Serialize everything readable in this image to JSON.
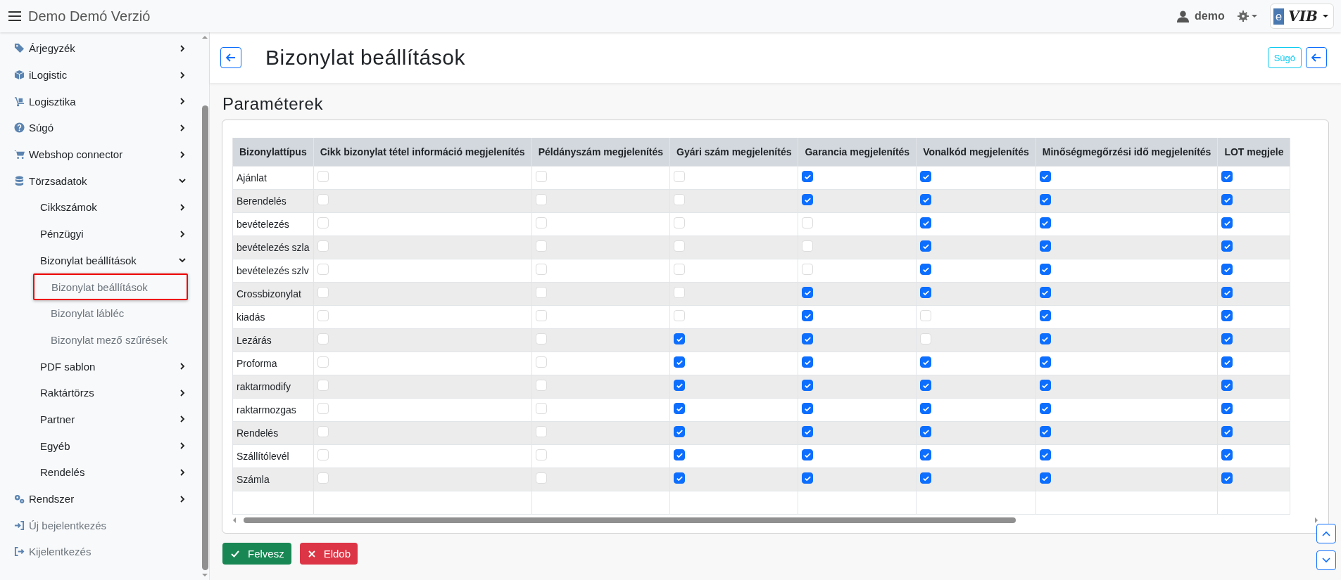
{
  "topbar": {
    "title": "Demo Demó Verzió",
    "user": "demo",
    "logo": {
      "mark": "e",
      "text": "VIB"
    }
  },
  "sidebar": {
    "items": [
      {
        "label": "Árjegyzék",
        "expanded": false
      },
      {
        "label": "iLogistic",
        "expanded": false
      },
      {
        "label": "Logisztika",
        "expanded": false
      },
      {
        "label": "Súgó",
        "expanded": false
      },
      {
        "label": "Webshop connector",
        "expanded": false
      },
      {
        "label": "Törzsadatok",
        "expanded": true,
        "children": [
          {
            "label": "Cikkszámok",
            "expanded": false
          },
          {
            "label": "Pénzügyi",
            "expanded": false
          },
          {
            "label": "Bizonylat beállítások",
            "expanded": true,
            "children": [
              {
                "label": "Bizonylat beállítások",
                "selected": true
              },
              {
                "label": "Bizonylat lábléc",
                "selected": false
              },
              {
                "label": "Bizonylat mező szűrések",
                "selected": false
              }
            ]
          },
          {
            "label": "PDF sablon",
            "expanded": false
          },
          {
            "label": "Raktártörzs",
            "expanded": false
          },
          {
            "label": "Partner",
            "expanded": false
          },
          {
            "label": "Egyéb",
            "expanded": false
          },
          {
            "label": "Rendelés",
            "expanded": false
          }
        ]
      },
      {
        "label": "Rendszer",
        "expanded": false
      }
    ],
    "actions": [
      "Új bejelentkezés",
      "Kijelentkezés"
    ]
  },
  "page": {
    "title": "Bizonylat beállítások",
    "help_button": "Súgó",
    "section": "Paraméterek"
  },
  "table": {
    "columns": [
      "Bizonylattípus",
      "Cikk bizonylat tétel információ megjelenítés",
      "Példányszám megjelenítés",
      "Gyári szám megjelenítés",
      "Garancia megjelenítés",
      "Vonalkód megjelenítés",
      "Minőségmegőrzési idő megjelenítés",
      "LOT megjele"
    ],
    "rows": [
      {
        "name": "Ajánlat",
        "checks": [
          false,
          false,
          false,
          true,
          true,
          true,
          true
        ]
      },
      {
        "name": "Berendelés",
        "checks": [
          false,
          false,
          false,
          true,
          true,
          true,
          true
        ]
      },
      {
        "name": "bevételezés",
        "checks": [
          false,
          false,
          false,
          false,
          true,
          true,
          true
        ]
      },
      {
        "name": "bevételezés szla",
        "checks": [
          false,
          false,
          false,
          false,
          true,
          true,
          true
        ]
      },
      {
        "name": "bevételezés szlv",
        "checks": [
          false,
          false,
          false,
          false,
          true,
          true,
          true
        ]
      },
      {
        "name": "Crossbizonylat",
        "checks": [
          false,
          false,
          false,
          true,
          true,
          true,
          true
        ]
      },
      {
        "name": "kiadás",
        "checks": [
          false,
          false,
          false,
          true,
          false,
          true,
          true
        ]
      },
      {
        "name": "Lezárás",
        "checks": [
          false,
          false,
          true,
          true,
          false,
          true,
          true
        ]
      },
      {
        "name": "Proforma",
        "checks": [
          false,
          false,
          true,
          true,
          true,
          true,
          true
        ]
      },
      {
        "name": "raktarmodify",
        "checks": [
          false,
          false,
          true,
          true,
          true,
          true,
          true
        ]
      },
      {
        "name": "raktarmozgas",
        "checks": [
          false,
          false,
          true,
          true,
          true,
          true,
          true
        ]
      },
      {
        "name": "Rendelés",
        "checks": [
          false,
          false,
          true,
          true,
          true,
          true,
          true
        ]
      },
      {
        "name": "Szállítólevél",
        "checks": [
          false,
          false,
          true,
          true,
          true,
          true,
          true
        ]
      },
      {
        "name": "Számla",
        "checks": [
          false,
          false,
          true,
          true,
          true,
          true,
          true
        ]
      }
    ]
  },
  "buttons": {
    "save": "Felvesz",
    "discard": "Eldob"
  }
}
